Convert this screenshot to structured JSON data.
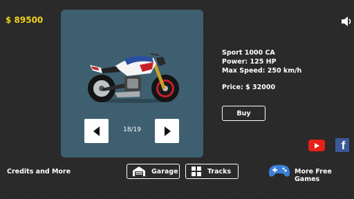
{
  "hud": {
    "money": "$ 89500"
  },
  "bike": {
    "counter": "18/19",
    "name": "Sport 1000 CA",
    "power": "Power: 125 HP",
    "max_speed": "Max Speed: 250 km/h",
    "price": "Price: $ 32000",
    "buy_label": "Buy"
  },
  "footer": {
    "credits_label": "Credits and More",
    "garage_label": "Garage",
    "tracks_label": "Tracks",
    "more_games_label": "More Free Games"
  },
  "social": {
    "facebook_glyph": "f"
  },
  "icons": [
    "speaker-icon",
    "arrow-left-icon",
    "arrow-right-icon",
    "youtube-icon",
    "facebook-icon",
    "garage-icon",
    "grid-icon",
    "gamepad-icon"
  ],
  "colors": {
    "money": "#f2d21c",
    "panel": "#3e5f6f",
    "youtube": "#e62117",
    "facebook": "#3b5998",
    "background": "#2a2a2a"
  }
}
